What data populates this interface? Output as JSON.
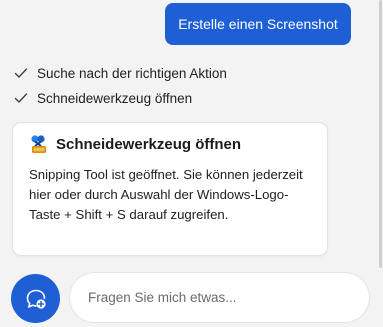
{
  "chat": {
    "user_message": "Erstelle einen Screenshot",
    "steps": [
      {
        "label": "Suche nach der richtigen Aktion",
        "icon": "check-icon"
      },
      {
        "label": "Schneidewerkzeug öffnen",
        "icon": "check-icon"
      }
    ],
    "card": {
      "icon": "snipping-tool-icon",
      "title": "Schneidewerkzeug öffnen",
      "body": "Snipping Tool ist geöffnet. Sie können jederzeit hier oder durch Auswahl der Windows-Logo-Taste + Shift + S darauf zugreifen."
    }
  },
  "composer": {
    "new_chat_icon": "new-chat-icon",
    "placeholder": "Fragen Sie mich etwas..."
  },
  "colors": {
    "accent": "#1f5fd6",
    "background": "#f3f3f3",
    "card": "#ffffff"
  }
}
